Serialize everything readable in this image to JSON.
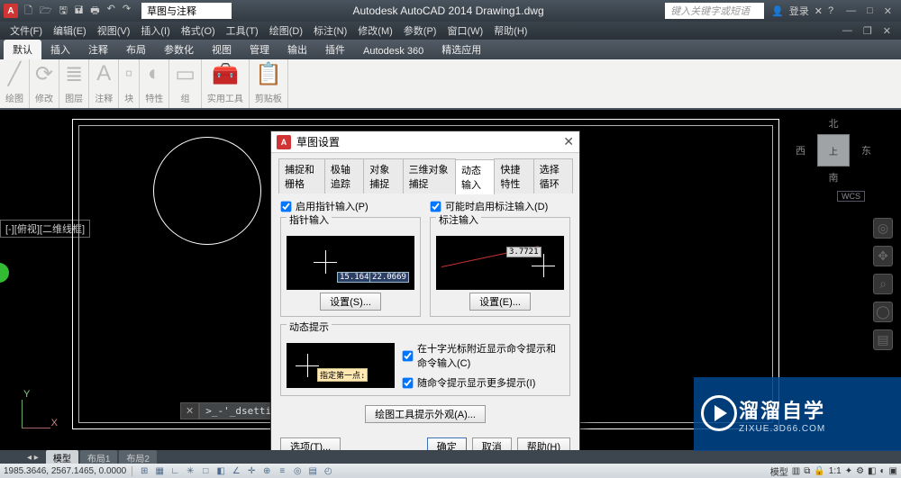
{
  "app": {
    "title": "Autodesk AutoCAD 2014   Drawing1.dwg",
    "search_placeholder": "键入关键字或短语",
    "login": "登录",
    "qat_combo": "草图与注释"
  },
  "menus": [
    "文件(F)",
    "编辑(E)",
    "视图(V)",
    "插入(I)",
    "格式(O)",
    "工具(T)",
    "绘图(D)",
    "标注(N)",
    "修改(M)",
    "参数(P)",
    "窗口(W)",
    "帮助(H)"
  ],
  "ribbon_tabs": [
    "默认",
    "插入",
    "注释",
    "布局",
    "参数化",
    "视图",
    "管理",
    "输出",
    "插件",
    "Autodesk 360",
    "精选应用"
  ],
  "ribbon_panels": [
    "绘图",
    "修改",
    "图层",
    "注释",
    "块",
    "特性",
    "组",
    "实用工具",
    "剪贴板"
  ],
  "viewport": {
    "label": "[-][俯视][二维线框]"
  },
  "navcube": {
    "n": "北",
    "s": "南",
    "e": "东",
    "w": "西",
    "top": "上",
    "wcs": "WCS"
  },
  "ucs": {
    "x": "X",
    "y": "Y"
  },
  "layout_tabs": [
    "模型",
    "布局1",
    "布局2"
  ],
  "command": {
    "text": ">_-'_dsettings"
  },
  "status": {
    "coords": "1985.3646, 2567.1465, 0.0000",
    "scale": "1:1",
    "model_btn": "模型"
  },
  "dialog": {
    "title": "草图设置",
    "tabs": [
      "捕捉和栅格",
      "极轴追踪",
      "对象捕捉",
      "三维对象捕捉",
      "动态输入",
      "快捷特性",
      "选择循环"
    ],
    "chk_pointer": "启用指针输入(P)",
    "chk_dim": "可能时启用标注输入(D)",
    "grp_pointer": "指针输入",
    "grp_dim": "标注输入",
    "btn_set_s": "设置(S)...",
    "btn_set_e": "设置(E)...",
    "grp_dyn": "动态提示",
    "dyn_hint_text": "指定第一点:",
    "chk_cross": "在十字光标附近显示命令提示和命令输入(C)",
    "chk_more": "随命令提示显示更多提示(I)",
    "btn_appearance": "绘图工具提示外观(A)...",
    "btn_options": "选项(T)...",
    "btn_ok": "确定",
    "btn_cancel": "取消",
    "btn_help": "帮助(H)",
    "coord1": "15.1643",
    "coord2": "22.0669",
    "dimval": "3.7721"
  },
  "watermark": {
    "big": "溜溜自学",
    "small": "ZIXUE.3D66.COM"
  }
}
